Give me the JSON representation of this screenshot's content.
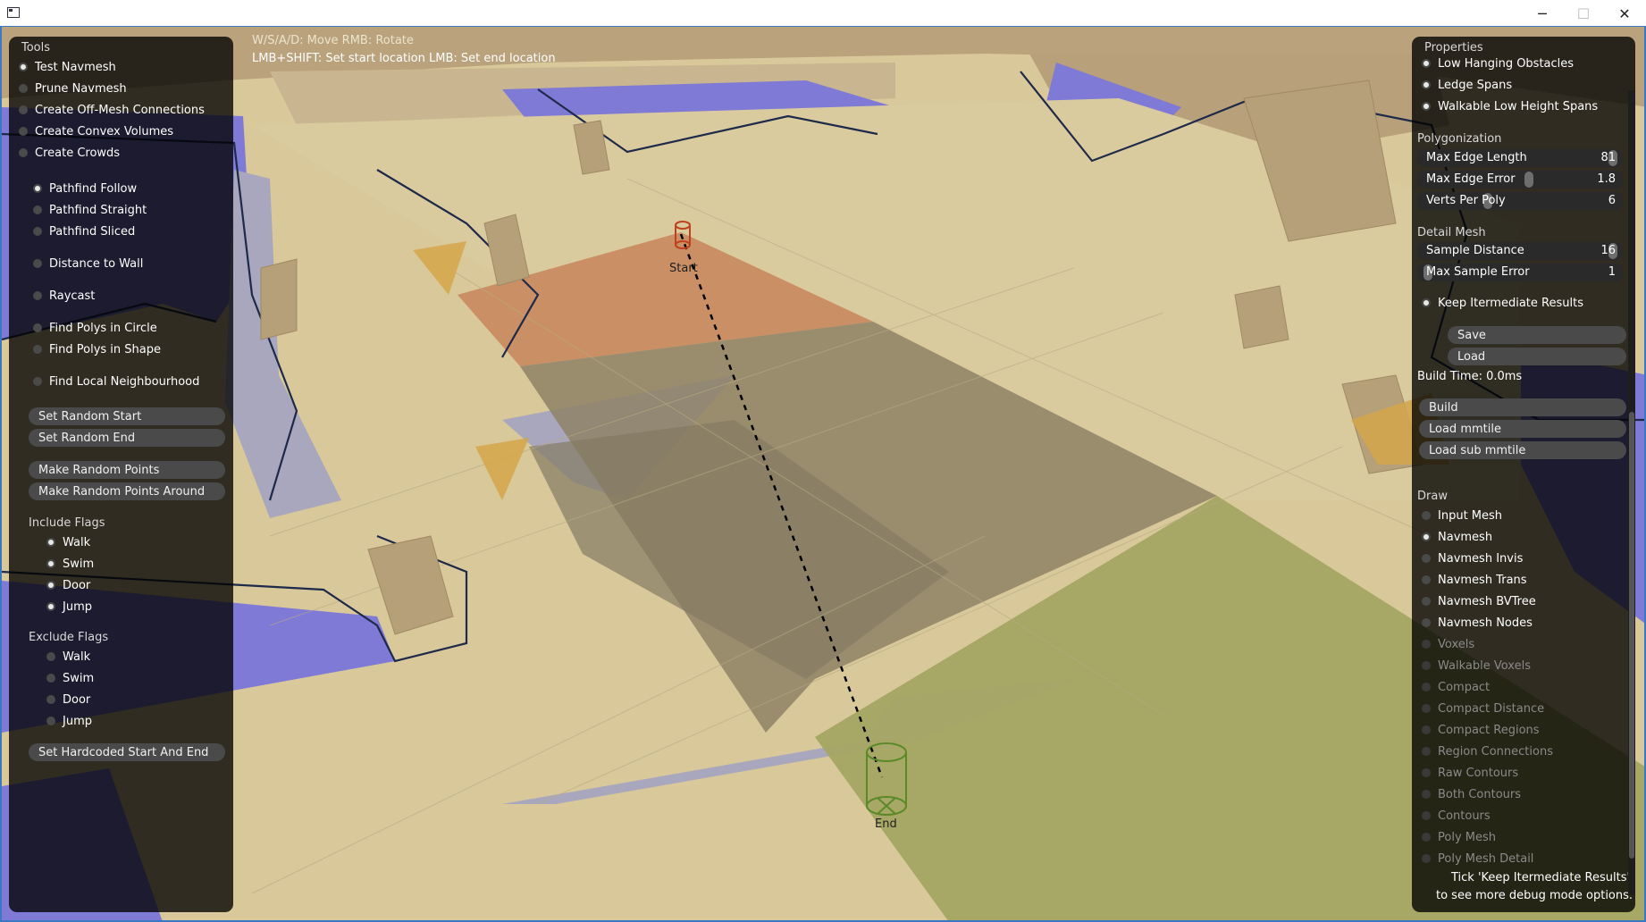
{
  "window": {
    "minimize": "─",
    "maximize": "☐",
    "close": "✕"
  },
  "hints": {
    "line1": "W/S/A/D: Move  RMB: Rotate",
    "line2": "LMB+SHIFT: Set start location  LMB: Set end location"
  },
  "markers": {
    "start": "Start",
    "end": "End"
  },
  "tools": {
    "title": "Tools",
    "tool_items": [
      {
        "label": "Test Navmesh",
        "selected": true
      },
      {
        "label": "Prune Navmesh",
        "selected": false
      },
      {
        "label": "Create Off-Mesh Connections",
        "selected": false
      },
      {
        "label": "Create Convex Volumes",
        "selected": false
      },
      {
        "label": "Create Crowds",
        "selected": false
      }
    ],
    "modes": [
      {
        "label": "Pathfind Follow",
        "selected": true
      },
      {
        "label": "Pathfind Straight",
        "selected": false
      },
      {
        "label": "Pathfind Sliced",
        "selected": false
      },
      {
        "label": "Distance to Wall",
        "selected": false
      },
      {
        "label": "Raycast",
        "selected": false
      },
      {
        "label": "Find Polys in Circle",
        "selected": false
      },
      {
        "label": "Find Polys in Shape",
        "selected": false
      },
      {
        "label": "Find Local Neighbourhood",
        "selected": false
      }
    ],
    "buttons": {
      "set_random_start": "Set Random Start",
      "set_random_end": "Set Random End",
      "make_random_points": "Make Random Points",
      "make_random_points_around": "Make Random Points Around",
      "set_hardcoded": "Set Hardcoded Start And End"
    },
    "include_flags": {
      "title": "Include Flags",
      "items": [
        {
          "label": "Walk",
          "checked": true
        },
        {
          "label": "Swim",
          "checked": true
        },
        {
          "label": "Door",
          "checked": true
        },
        {
          "label": "Jump",
          "checked": true
        }
      ]
    },
    "exclude_flags": {
      "title": "Exclude Flags",
      "items": [
        {
          "label": "Walk",
          "checked": false
        },
        {
          "label": "Swim",
          "checked": false
        },
        {
          "label": "Door",
          "checked": false
        },
        {
          "label": "Jump",
          "checked": false
        }
      ]
    }
  },
  "properties": {
    "title": "Properties",
    "filter_items": [
      {
        "label": "Low Hanging Obstacles",
        "checked": true
      },
      {
        "label": "Ledge Spans",
        "checked": true
      },
      {
        "label": "Walkable Low Height Spans",
        "checked": true
      }
    ],
    "polygonization": {
      "title": "Polygonization",
      "sliders": [
        {
          "label": "Max Edge Length",
          "value": "81",
          "fraction": 0.98
        },
        {
          "label": "Max Edge Error",
          "value": "1.8",
          "fraction": 0.55
        },
        {
          "label": "Verts Per Poly",
          "value": "6",
          "fraction": 0.34
        }
      ]
    },
    "detail_mesh": {
      "title": "Detail Mesh",
      "sliders": [
        {
          "label": "Sample Distance",
          "value": "16",
          "fraction": 0.98
        },
        {
          "label": "Max Sample Error",
          "value": "1",
          "fraction": 0.03
        }
      ]
    },
    "keep_intermediate": {
      "label": "Keep Itermediate Results",
      "checked": true
    },
    "save": "Save",
    "load": "Load",
    "build_time": "Build Time: 0.0ms",
    "build": "Build",
    "load_mmtile": "Load mmtile",
    "load_sub_mmtile": "Load sub mmtile",
    "draw": {
      "title": "Draw",
      "items": [
        {
          "label": "Input Mesh",
          "checked": false,
          "enabled": true
        },
        {
          "label": "Navmesh",
          "checked": true,
          "enabled": true
        },
        {
          "label": "Navmesh Invis",
          "checked": false,
          "enabled": true
        },
        {
          "label": "Navmesh Trans",
          "checked": false,
          "enabled": true
        },
        {
          "label": "Navmesh BVTree",
          "checked": false,
          "enabled": true
        },
        {
          "label": "Navmesh Nodes",
          "checked": false,
          "enabled": true
        },
        {
          "label": "Voxels",
          "checked": false,
          "enabled": false
        },
        {
          "label": "Walkable Voxels",
          "checked": false,
          "enabled": false
        },
        {
          "label": "Compact",
          "checked": false,
          "enabled": false
        },
        {
          "label": "Compact Distance",
          "checked": false,
          "enabled": false
        },
        {
          "label": "Compact Regions",
          "checked": false,
          "enabled": false
        },
        {
          "label": "Region Connections",
          "checked": false,
          "enabled": false
        },
        {
          "label": "Raw Contours",
          "checked": false,
          "enabled": false
        },
        {
          "label": "Both Contours",
          "checked": false,
          "enabled": false
        },
        {
          "label": "Contours",
          "checked": false,
          "enabled": false
        },
        {
          "label": "Poly Mesh",
          "checked": false,
          "enabled": false
        },
        {
          "label": "Poly Mesh Detail",
          "checked": false,
          "enabled": false
        }
      ]
    },
    "footer_line1": "Tick 'Keep Itermediate Results'",
    "footer_line2": "to see more debug mode options."
  },
  "colors": {
    "ground": "#d8c89a",
    "navmesh_blue": "#7f7ad6",
    "path_start_poly": "#c98a5f",
    "path_poly": "#8e8266",
    "end_poly": "#a4a563",
    "start_marker": "#c0401e",
    "end_marker": "#5a8a28"
  }
}
